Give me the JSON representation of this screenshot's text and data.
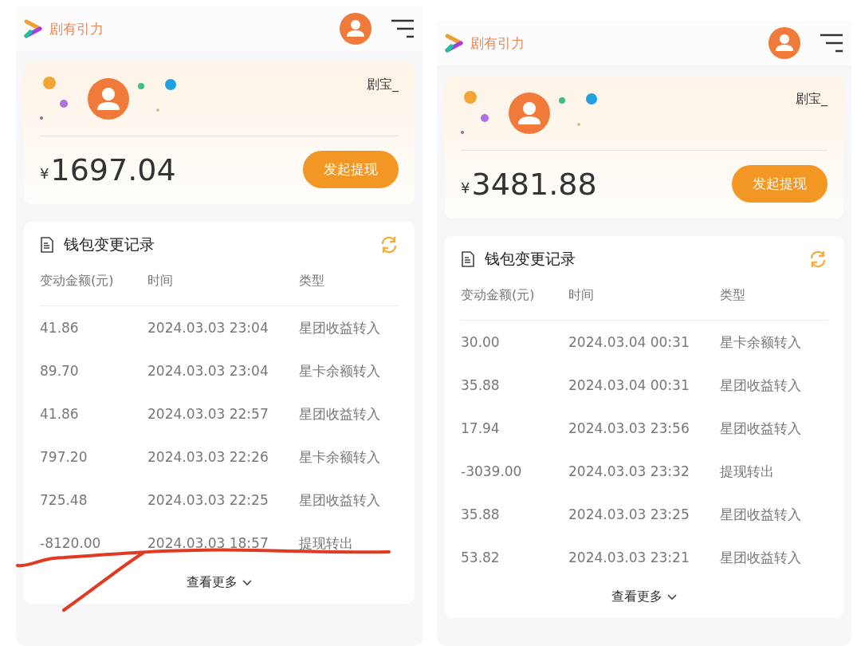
{
  "screens": [
    {
      "brand": "剧有引力",
      "username": "剧宝_",
      "balance_symbol": "¥",
      "balance": "1697.04",
      "withdraw_button": "发起提现",
      "records_title": "钱包变更记录",
      "columns": [
        "变动金额(元)",
        "时间",
        "类型"
      ],
      "rows": [
        {
          "amount": "41.86",
          "time": "2024.03.03 23:04",
          "type": "星团收益转入"
        },
        {
          "amount": "89.70",
          "time": "2024.03.03 23:04",
          "type": "星卡余额转入"
        },
        {
          "amount": "41.86",
          "time": "2024.03.03 22:57",
          "type": "星团收益转入"
        },
        {
          "amount": "797.20",
          "time": "2024.03.03 22:26",
          "type": "星卡余额转入"
        },
        {
          "amount": "725.48",
          "time": "2024.03.03 22:25",
          "type": "星团收益转入"
        },
        {
          "amount": "-8120.00",
          "time": "2024.03.03 18:57",
          "type": "提现转出"
        }
      ],
      "more_link": "查看更多",
      "pen_marks": true
    },
    {
      "brand": "剧有引力",
      "username": "剧宝_",
      "balance_symbol": "¥",
      "balance": "3481.88",
      "withdraw_button": "发起提现",
      "records_title": "钱包变更记录",
      "columns": [
        "变动金额(元)",
        "时间",
        "类型"
      ],
      "rows": [
        {
          "amount": "30.00",
          "time": "2024.03.04 00:31",
          "type": "星卡余额转入"
        },
        {
          "amount": "35.88",
          "time": "2024.03.04 00:31",
          "type": "星团收益转入"
        },
        {
          "amount": "17.94",
          "time": "2024.03.03 23:56",
          "type": "星团收益转入"
        },
        {
          "amount": "-3039.00",
          "time": "2024.03.03 23:32",
          "type": "提现转出"
        },
        {
          "amount": "35.88",
          "time": "2024.03.03 23:25",
          "type": "星团收益转入"
        },
        {
          "amount": "53.82",
          "time": "2024.03.03 23:21",
          "type": "星团收益转入"
        }
      ],
      "more_link": "查看更多",
      "pen_marks": false
    }
  ]
}
